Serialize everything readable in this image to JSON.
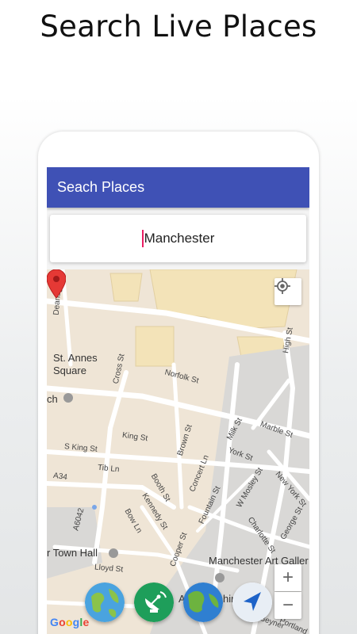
{
  "headline": "Search Live Places",
  "appbar": {
    "title": "Seach Places"
  },
  "search": {
    "value": "Manchester"
  },
  "map": {
    "labels": {
      "deansgate": "Deansgate",
      "st_annes_square": "St. Annes\nSquare",
      "church": "ch",
      "cross_st": "Cross St",
      "norfolk_st": "Norfolk St",
      "high_st": "High St",
      "king_st_1": "King St",
      "s_king_st": "S King St",
      "brown_st": "Brown St",
      "milk_st": "Milk St",
      "marble_st": "Marble St",
      "tib_ln": "Tib Ln",
      "york_st": "York St",
      "concert_ln": "Concert Ln",
      "a34": "A34",
      "booth_st": "Booth St",
      "w_mosley_st": "W Mosley St",
      "new_york_st": "New York St",
      "kennedy_st": "Kennedy St",
      "fountain_st": "Fountain St",
      "george_st": "George St",
      "a6042": "A6042",
      "bow_ln": "Bow Ln",
      "charlotte_st": "Charlotte St",
      "town_hall": "r Town Hall",
      "cooper_st": "Cooper St",
      "manchester_art_gallery": "Manchester Art Galler",
      "lloyd_st": "Lloyd St",
      "art_gallery_short": "Ar",
      "art_gallery_short2": "hin",
      "beyner": "Beyner",
      "portland": "Portland"
    },
    "controls": {
      "zoom_in": "+",
      "zoom_out": "−"
    },
    "attribution": {
      "g1": "G",
      "g2": "o",
      "g3": "o",
      "g4": "g",
      "g5": "l",
      "g6": "e"
    }
  },
  "fabs": [
    {
      "name": "earth-globe-button",
      "icon": "earth-globe-icon"
    },
    {
      "name": "satellite-dish-button",
      "icon": "satellite-dish-icon"
    },
    {
      "name": "world-map-button",
      "icon": "world-globe-icon"
    },
    {
      "name": "navigation-button",
      "icon": "navigation-arrow-icon"
    }
  ],
  "colors": {
    "appbar": "#3f51b5",
    "caret": "#e91e63",
    "pin": "#e53935",
    "map_land": "#efe5d6",
    "map_road": "#ffffff"
  }
}
